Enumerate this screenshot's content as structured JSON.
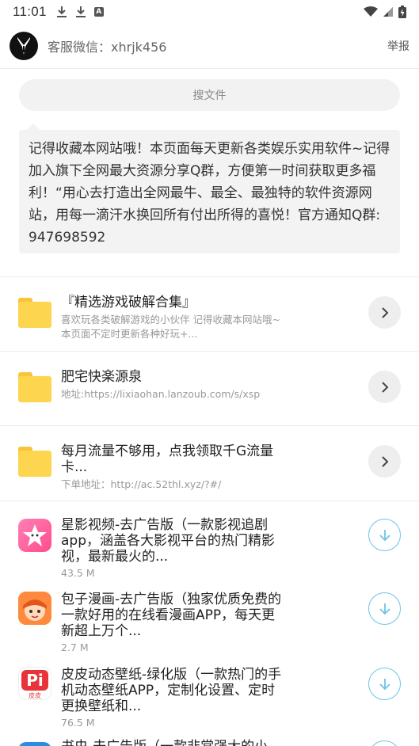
{
  "status_bar": {
    "time": "11:01"
  },
  "header": {
    "service_text": "客服微信：xhrjk456",
    "report_label": "举报"
  },
  "search": {
    "placeholder": "搜文件"
  },
  "notice": {
    "text": "记得收藏本网站哦！本页面每天更新各类娱乐实用软件~记得加入旗下全网最大资源分享Q群，方便第一时间获取更多福利！“用心去打造出全网最牛、最全、最独特的软件资源网站，用每一滴汗水换回所有付出所得的喜悦！官方通知Q群: 947698592"
  },
  "folders": [
    {
      "title": "『精选游戏破解合集』",
      "subtitle": "喜欢玩各类破解游戏的小伙伴 记得收藏本网站哦~本页面不定时更新各种好玩+...",
      "icon": "folder-icon"
    },
    {
      "title": "肥宅快楽源泉",
      "subtitle": "地址:https://lixiaohan.lanzoub.com/s/xsp",
      "icon": "folder-icon"
    },
    {
      "title": "每月流量不够用，点我领取千G流量卡...",
      "subtitle": "下单地址：http://ac.52thl.xyz/?#/",
      "icon": "folder-icon"
    }
  ],
  "files": [
    {
      "title": "星影视频-去广告版（一款影视追剧app，涵盖各大影视平台的热门精影视，最新最火的...",
      "size": "43.5 M",
      "icon": "star-video-app-icon"
    },
    {
      "title": "包子漫画-去广告版（独家优质免费的一款好用的在线看漫画APP，每天更新超上万个...",
      "size": "2.7 M",
      "icon": "baozi-comic-app-icon"
    },
    {
      "title": "皮皮动态壁纸-绿化版（一款热门的手机动态壁纸APP，定制化设置、定时更换壁纸和...",
      "size": "76.5 M",
      "icon": "pipi-wallpaper-app-icon",
      "icon_label": "Pi",
      "icon_sublabel": "皮皮"
    },
    {
      "title": "书虫-去广告版（一款非常强大的小",
      "size": "",
      "icon": "bookworm-app-icon"
    }
  ],
  "colors": {
    "folder": "#fdd54f",
    "download_accent": "#6fc3e8",
    "pipi_red": "#e8333a"
  }
}
